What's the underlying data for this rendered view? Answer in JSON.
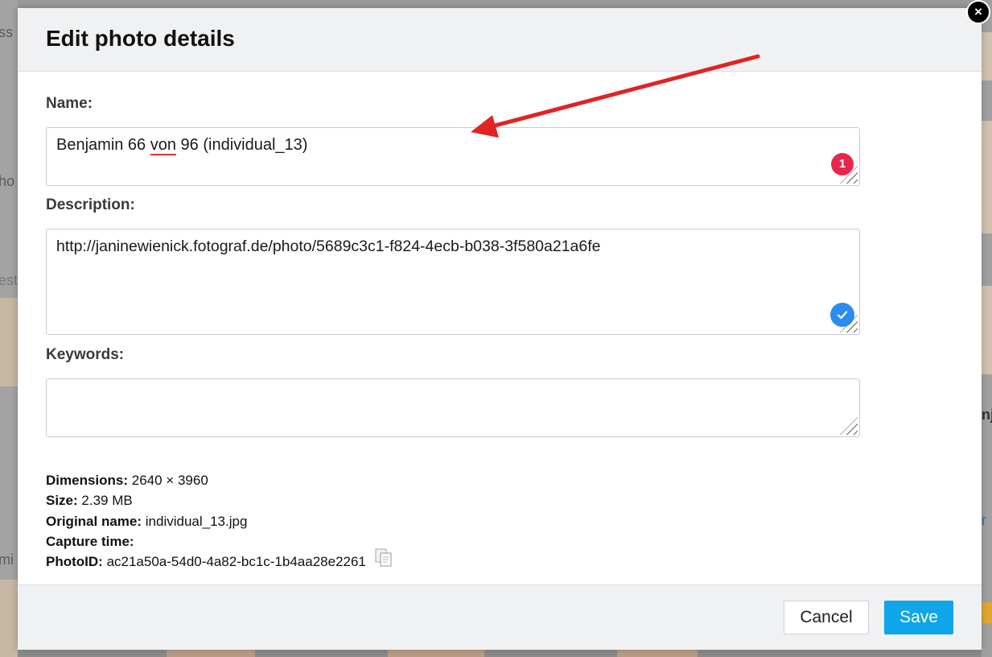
{
  "background": {
    "left_fragments": [
      "ss",
      "ho",
      "est",
      "mi"
    ],
    "right_fragments": [
      "nj",
      "r"
    ]
  },
  "dialog": {
    "title": "Edit photo details",
    "close_icon": "×"
  },
  "form": {
    "name": {
      "label": "Name:",
      "value_before": "Benjamin 66 ",
      "value_misspelled": "von",
      "value_after": " 96 (individual_13)",
      "badge_count": "1"
    },
    "description": {
      "label": "Description:",
      "value": "http://janinewienick.fotograf.de/photo/5689c3c1-f824-4ecb-b038-3f580a21a6fe",
      "badge_icon": "checkmark-icon"
    },
    "keywords": {
      "label": "Keywords:",
      "value": ""
    }
  },
  "meta": {
    "dimensions_label": "Dimensions:",
    "dimensions_value": "2640 × 3960",
    "size_label": "Size:",
    "size_value": "2.39 MB",
    "original_name_label": "Original name:",
    "original_name_value": "individual_13.jpg",
    "capture_time_label": "Capture time:",
    "capture_time_value": "",
    "photoid_label": "PhotoID:",
    "photoid_value": "ac21a50a-54d0-4a82-bc1c-1b4aa28e2261"
  },
  "footer": {
    "cancel_label": "Cancel",
    "save_label": "Save"
  },
  "colors": {
    "save_button": "#0ea5e9",
    "error_badge": "#e8264c",
    "ok_badge": "#2a8cf0",
    "annotation_arrow": "#e02424"
  }
}
